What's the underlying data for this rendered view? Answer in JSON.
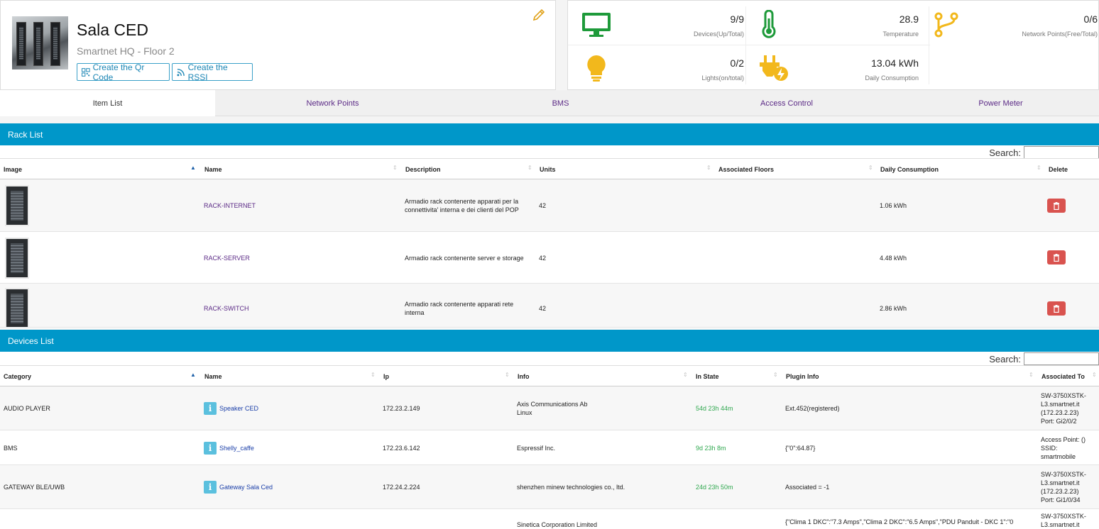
{
  "room": {
    "title": "Sala CED",
    "subtitle": "Smartnet HQ - Floor 2",
    "qr_button": "Create the Qr Code",
    "rssi_button": "Create the RSSI"
  },
  "stats": {
    "devices": {
      "value": "9/9",
      "label": "Devices(Up/Total)",
      "color": "#1e9a3a",
      "icon": "monitor-icon"
    },
    "temperature": {
      "value": "28.9",
      "label": "Temperature",
      "color": "#1e9a3a",
      "icon": "thermometer-icon"
    },
    "network": {
      "value": "0/6",
      "label": "Network Points(Free/Total)",
      "color": "#f2b81c",
      "icon": "network-branch-icon"
    },
    "lights": {
      "value": "0/2",
      "label": "Lights(on/total)",
      "color": "#f2b81c",
      "icon": "bulb-icon"
    },
    "consumption": {
      "value": "13.04 kWh",
      "label": "Daily Consumption",
      "color": "#f2b81c",
      "icon": "plug-icon"
    }
  },
  "tabs": [
    "Item List",
    "Network Points",
    "BMS",
    "Access Control",
    "Power Meter"
  ],
  "rack_list": {
    "title": "Rack List",
    "search_label": "Search:",
    "columns": [
      "Image",
      "Name",
      "Description",
      "Units",
      "Associated Floors",
      "Daily Consumption",
      "Delete"
    ],
    "rows": [
      {
        "name": "RACK-INTERNET",
        "description": "Armadio rack contenente apparati per la connettivita' interna e dei clienti del POP",
        "units": "42",
        "floors": "",
        "consumption": "1.06 kWh"
      },
      {
        "name": "RACK-SERVER",
        "description": "Armadio rack contenente server e storage",
        "units": "42",
        "floors": "",
        "consumption": "4.48 kWh"
      },
      {
        "name": "RACK-SWITCH",
        "description": "Armadio rack contenente apparati rete interna",
        "units": "42",
        "floors": "",
        "consumption": "2.86 kWh"
      }
    ]
  },
  "devices_list": {
    "title": "Devices List",
    "search_label": "Search:",
    "columns": [
      "Category",
      "Name",
      "Ip",
      "Info",
      "In State",
      "Plugin Info",
      "Associated To"
    ],
    "rows": [
      {
        "category": "AUDIO PLAYER",
        "name": "Speaker CED",
        "ip": "172.23.2.149",
        "info": "Axis Communications Ab\nLinux",
        "state": "54d 23h 44m",
        "plugin": "Ext.452(registered)",
        "assoc": "SW-3750XSTK-\nL3.smartnet.it\n(172.23.2.23)\nPort: Gi2/0/2"
      },
      {
        "category": "BMS",
        "name": "Shelly_caffe",
        "ip": "172.23.6.142",
        "info": "Espressif Inc.",
        "state": "9d 23h 8m",
        "plugin": "{\"0\":64.87}",
        "assoc": "Access Point: ()\nSSID:\nsmartmobile"
      },
      {
        "category": "GATEWAY BLE/UWB",
        "name": "Gateway Sala Ced",
        "ip": "172.24.2.224",
        "info": "shenzhen minew technologies co., ltd.",
        "state": "24d 23h 50m",
        "plugin": "Associated = -1",
        "assoc": "SW-3750XSTK-\nL3.smartnet.it\n(172.23.2.23)\nPort: Gi1/0/34"
      },
      {
        "category": "",
        "name": "",
        "ip": "",
        "info": "Sinetica Corporation Limited",
        "state": "",
        "plugin": "{\"Clima 1 DKC\":\"7.3 Amps\",\"Clima 2 DKC\":\"6.5 Amps\",\"PDU Panduit - DKC 1\":\"0",
        "assoc": "SW-3750XSTK-\nL3.smartnet.it"
      }
    ]
  }
}
